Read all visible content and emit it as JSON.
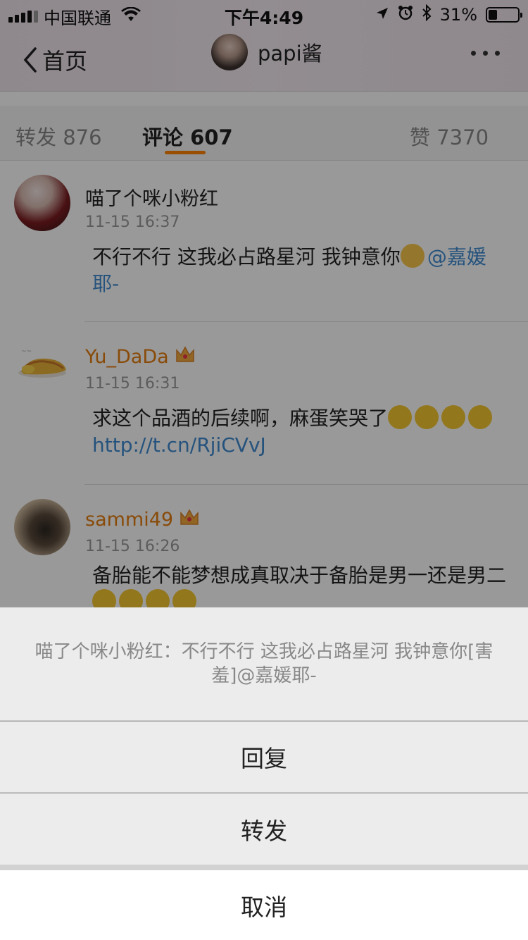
{
  "status_bar": {
    "carrier": "中国联通",
    "time": "下午4:49",
    "battery": "31%",
    "battery_level": 0.31
  },
  "nav": {
    "back_label": "首页",
    "title": "papi酱"
  },
  "tabs": [
    {
      "label": "转发 876"
    },
    {
      "label": "评论 607"
    },
    {
      "label": "赞 7370"
    }
  ],
  "comments": [
    {
      "name": "喵了个咪小粉红",
      "time": "11-15 16:37",
      "text": "不行不行 这我必占路星河  我钟意你",
      "mention": "@嘉媛耶-"
    },
    {
      "name": "Yu_DaDa",
      "time": "11-15 16:31",
      "text": "求这个品酒的后续啊，麻蛋笑哭了",
      "link": "http://t.cn/RjiCVvJ"
    },
    {
      "name": "sammi49",
      "time": "11-15 16:26",
      "text": "备胎能不能梦想成真取决于备胎是男一还是男二"
    }
  ],
  "sheet": {
    "message": "喵了个咪小粉红：不行不行 这我必占路星河  我钟意你[害羞]@嘉媛耶-",
    "reply": "回复",
    "forward": "转发",
    "cancel": "取消"
  }
}
